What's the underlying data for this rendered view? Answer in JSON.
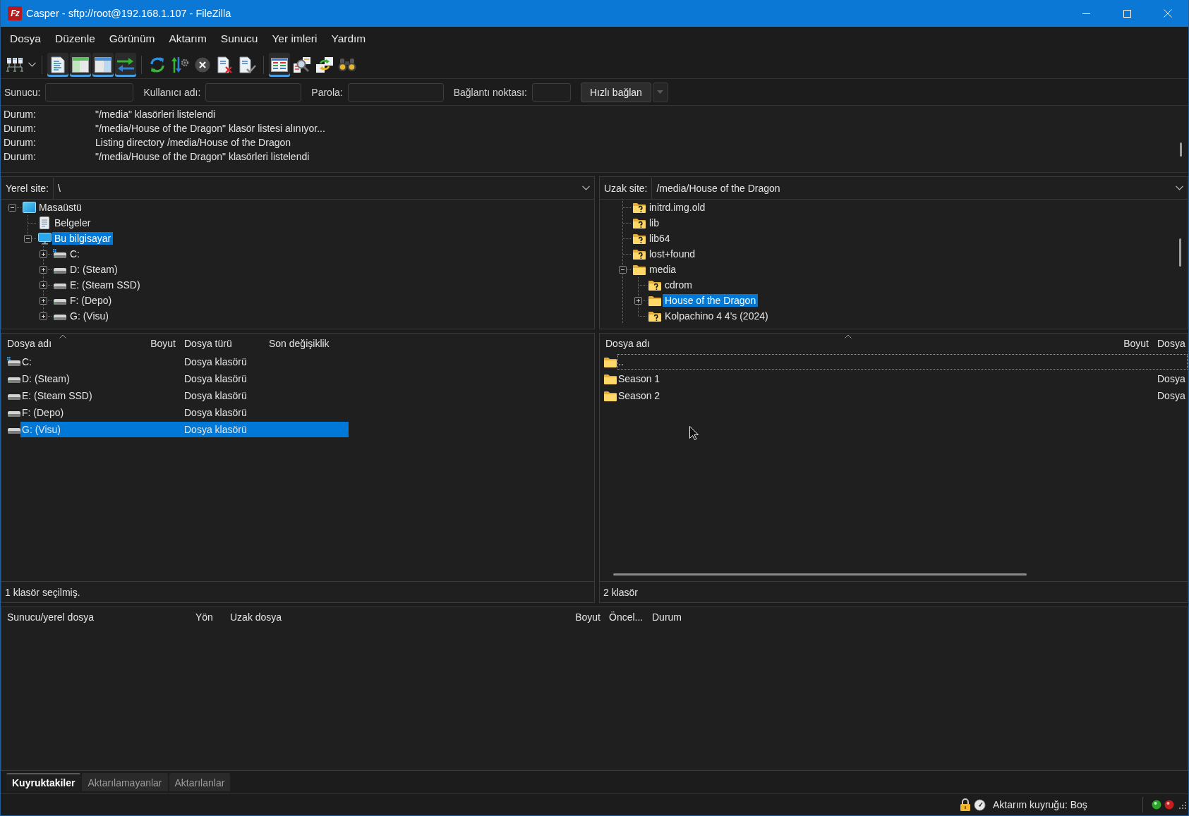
{
  "window": {
    "logo": "Fz",
    "title": "Casper - sftp://root@192.168.1.107 - FileZilla"
  },
  "menu": [
    "Dosya",
    "Düzenle",
    "Görünüm",
    "Aktarım",
    "Sunucu",
    "Yer imleri",
    "Yardım"
  ],
  "toolbar": [
    {
      "toggled": false
    },
    {
      "toggled": true
    },
    {
      "toggled": true
    },
    {
      "toggled": true
    },
    {
      "toggled": true
    },
    {
      "toggled": false
    },
    {
      "toggled": false
    },
    {
      "toggled": false
    },
    {
      "toggled": false
    },
    {
      "toggled": false
    },
    {
      "toggled": true
    },
    {
      "toggled": false
    },
    {
      "toggled": false
    },
    {
      "toggled": false
    }
  ],
  "quickconnect": {
    "fields": [
      {
        "label": "Sunucu:"
      },
      {
        "label": "Kullanıcı adı:"
      },
      {
        "label": "Parola:"
      },
      {
        "label": "Bağlantı noktası:"
      }
    ],
    "connect_button": "Hızlı bağlan",
    "history_dropdown": {
      "disabled": true
    }
  },
  "message_log": [
    {
      "prefix": "Durum:",
      "message": "\"/media\" klasörleri listelendi"
    },
    {
      "prefix": "Durum:",
      "message": "\"/media/House of the Dragon\" klasör listesi alınıyor..."
    },
    {
      "prefix": "Durum:",
      "message": "Listing directory /media/House of the Dragon"
    },
    {
      "prefix": "Durum:",
      "message": "\"/media/House of the Dragon\" klasörleri listelendi"
    }
  ],
  "local": {
    "site_label": "Yerel site:",
    "path": "\\",
    "tree": [
      {
        "label": "Masaüstü",
        "kind": "desktop",
        "expanded": true,
        "selected": false,
        "children": [
          {
            "label": "Belgeler",
            "kind": "documents",
            "selected": false
          },
          {
            "label": "Bu bilgisayar",
            "kind": "computer",
            "expanded": true,
            "selected": true,
            "children": [
              {
                "label": "C:",
                "kind": "systemdrive",
                "expanded": false,
                "selected": false
              },
              {
                "label": "D: (Steam)",
                "kind": "drive",
                "expanded": false,
                "selected": false
              },
              {
                "label": "E: (Steam SSD)",
                "kind": "drive",
                "expanded": false,
                "selected": false
              },
              {
                "label": "F: (Depo)",
                "kind": "drive",
                "expanded": false,
                "selected": false
              },
              {
                "label": "G: (Visu)",
                "kind": "drive",
                "expanded": false,
                "selected": false
              }
            ]
          }
        ]
      }
    ],
    "file_list": {
      "columns": [
        {
          "label": "Dosya adı",
          "sorted": true
        },
        {
          "label": "Boyut",
          "sorted": false
        },
        {
          "label": "Dosya türü",
          "sorted": false
        },
        {
          "label": "Son değişiklik",
          "sorted": false
        }
      ],
      "rows": [
        {
          "name": "C:",
          "kind": "systemdrive",
          "type": "Dosya klasörü",
          "selected": false
        },
        {
          "name": "D: (Steam)",
          "kind": "drive",
          "type": "Dosya klasörü",
          "selected": false
        },
        {
          "name": "E: (Steam SSD)",
          "kind": "drive",
          "type": "Dosya klasörü",
          "selected": false
        },
        {
          "name": "F: (Depo)",
          "kind": "drive",
          "type": "Dosya klasörü",
          "selected": false
        },
        {
          "name": "G: (Visu)",
          "kind": "drive",
          "type": "Dosya klasörü",
          "selected": true
        }
      ]
    },
    "status": "1 klasör seçilmiş."
  },
  "remote": {
    "site_label": "Uzak site:",
    "path": "/media/House of the Dragon",
    "tree": [
      {
        "label": "initrd.img.old",
        "kind": "unknown",
        "selected": false
      },
      {
        "label": "lib",
        "kind": "unknown",
        "selected": false
      },
      {
        "label": "lib64",
        "kind": "unknown",
        "selected": false
      },
      {
        "label": "lost+found",
        "kind": "unknown",
        "selected": false
      },
      {
        "label": "media",
        "kind": "folder",
        "expanded": true,
        "selected": false,
        "children": [
          {
            "label": "cdrom",
            "kind": "unknown",
            "selected": false
          },
          {
            "label": "House of the Dragon",
            "kind": "folder",
            "expanded": false,
            "selected": true
          },
          {
            "label": "Kolpachino 4 4's (2024)",
            "kind": "unknown",
            "selected": false
          }
        ]
      }
    ],
    "file_list": {
      "columns": [
        {
          "label": "Dosya adı",
          "sorted": true
        },
        {
          "label": "Boyut",
          "sorted": false
        },
        {
          "label": "Dosya",
          "sorted": false
        }
      ],
      "rows": [
        {
          "name": "..",
          "kind": "folder",
          "selected": false,
          "focused": true
        },
        {
          "name": "Season 1",
          "kind": "folder",
          "type": "Dosya",
          "selected": false,
          "focused": false
        },
        {
          "name": "Season 2",
          "kind": "folder",
          "type": "Dosya",
          "selected": false,
          "focused": false
        }
      ]
    },
    "status": "2 klasör"
  },
  "queue": {
    "columns": [
      "Sunucu/yerel dosya",
      "Yön",
      "Uzak dosya",
      "Boyut",
      "Öncel...",
      "Durum"
    ],
    "tabs": [
      {
        "label": "Kuyruktakiler",
        "selected": true
      },
      {
        "label": "Aktarılamayanlar",
        "selected": false
      },
      {
        "label": "Aktarılanlar",
        "selected": false
      }
    ]
  },
  "status_bar": {
    "queue_status": "Aktarım kuyruğu: Boş"
  }
}
